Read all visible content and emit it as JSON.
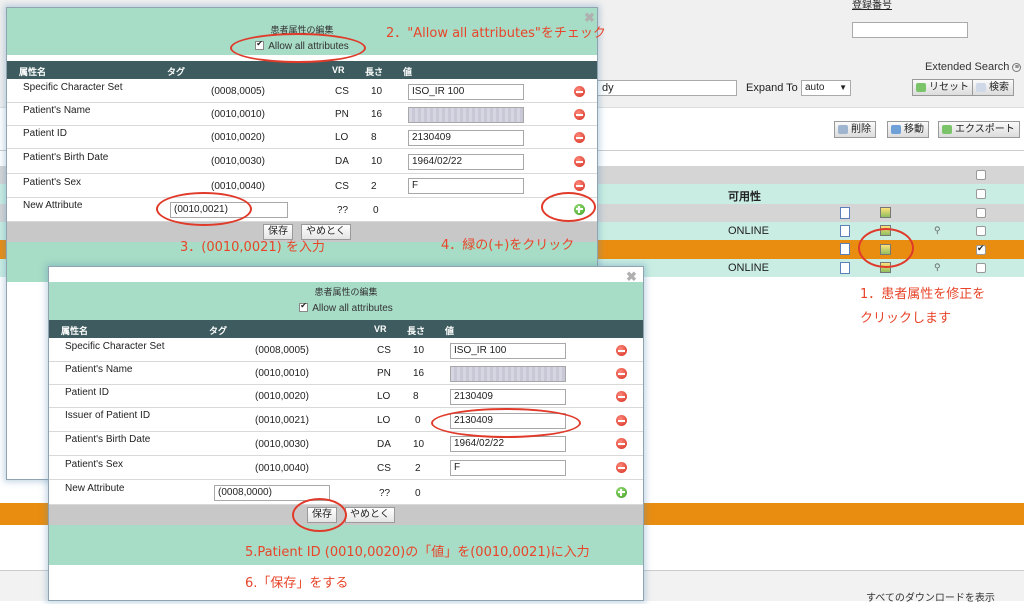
{
  "colors": {
    "dialog_green": "#a7dcc6",
    "header_dark": "#3e5c5f",
    "highlight_orange": "#e98d11",
    "teal_row": "#c9ede2",
    "annotation_red": "#e8452a"
  },
  "background": {
    "reg_label": "登録番号",
    "ext_search": "Extended Search",
    "dy_value": "dy",
    "expand_label": "Expand To",
    "expand_value": "auto",
    "reset_button": "リセット",
    "search_button": "検索",
    "delete_button": "削除",
    "move_button": "移動",
    "export_button": "エクスポート",
    "availability_header": "可用性",
    "online_1": "ONLINE",
    "online_2": "ONLINE",
    "bottom_text": "すべてのダウンロードを表示"
  },
  "dialog1": {
    "title": "患者属性の編集",
    "allow_all": "Allow all attributes",
    "headers": {
      "name": "属性名",
      "tag": "タグ",
      "vr": "VR",
      "length": "長さ",
      "value": "値"
    },
    "rows": [
      {
        "name": "Specific Character Set",
        "tag": "(0008,0005)",
        "vr": "CS",
        "length": "10",
        "value": "ISO_IR 100"
      },
      {
        "name": "Patient's Name",
        "tag": "(0010,0010)",
        "vr": "PN",
        "length": "16",
        "value": ""
      },
      {
        "name": "Patient ID",
        "tag": "(0010,0020)",
        "vr": "LO",
        "length": "8",
        "value": "2130409"
      },
      {
        "name": "Patient's Birth Date",
        "tag": "(0010,0030)",
        "vr": "DA",
        "length": "10",
        "value": "1964/02/22"
      },
      {
        "name": "Patient's Sex",
        "tag": "(0010,0040)",
        "vr": "CS",
        "length": "2",
        "value": "F"
      }
    ],
    "new_attr": {
      "name": "New Attribute",
      "tag_value": "(0010,0021)",
      "vr": "??",
      "length": "0"
    },
    "save": "保存",
    "cancel": "やめとく"
  },
  "dialog2": {
    "title": "患者属性の編集",
    "allow_all": "Allow all attributes",
    "headers": {
      "name": "属性名",
      "tag": "タグ",
      "vr": "VR",
      "length": "長さ",
      "value": "値"
    },
    "rows": [
      {
        "name": "Specific Character Set",
        "tag": "(0008,0005)",
        "vr": "CS",
        "length": "10",
        "value": "ISO_IR 100"
      },
      {
        "name": "Patient's Name",
        "tag": "(0010,0010)",
        "vr": "PN",
        "length": "16",
        "value": ""
      },
      {
        "name": "Patient ID",
        "tag": "(0010,0020)",
        "vr": "LO",
        "length": "8",
        "value": "2130409"
      },
      {
        "name": "Issuer of Patient ID",
        "tag": "(0010,0021)",
        "vr": "LO",
        "length": "0",
        "value": "2130409"
      },
      {
        "name": "Patient's Birth Date",
        "tag": "(0010,0030)",
        "vr": "DA",
        "length": "10",
        "value": "1964/02/22"
      },
      {
        "name": "Patient's Sex",
        "tag": "(0010,0040)",
        "vr": "CS",
        "length": "2",
        "value": "F"
      }
    ],
    "new_attr": {
      "name": "New Attribute",
      "tag_value": "(0008,0000)",
      "vr": "??",
      "length": "0"
    },
    "save": "保存",
    "cancel": "やめとく"
  },
  "annotations": {
    "step1_line1": "1．患者属性を修正を",
    "step1_line2": "クリックします",
    "step2": "2．\"Allow all attributes\"をチェック",
    "step3": "3．(0010,0021) を入力",
    "step4": "4．緑の(+)をクリック",
    "step5": "5.Patient ID (0010,0020)の「値」を(0010,0021)に入力",
    "step6": "6.「保存」をする"
  }
}
